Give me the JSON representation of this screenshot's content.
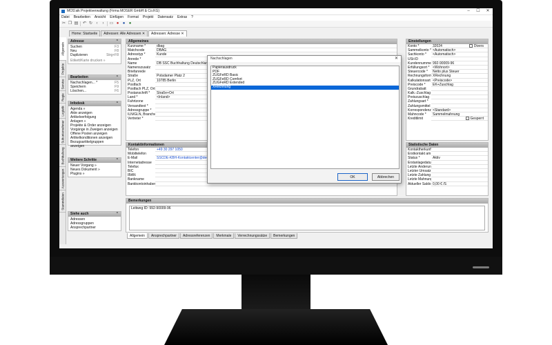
{
  "window": {
    "title": "MOS'aik Projektverwaltung (Firma MOSER GmbH & Co.KG)"
  },
  "menu": [
    "Datei",
    "Bearbeiten",
    "Ansicht",
    "Einfügen",
    "Format",
    "Projekt",
    "Datensatz",
    "Extras",
    "?"
  ],
  "tabs": [
    "Home: Startseite",
    "Adressen: Alle Adressen ✕",
    "Adressen: Adresse ✕"
  ],
  "vtabs": [
    "Allgemein",
    "Projekte",
    "Service",
    "Regie",
    "Logistik",
    "Subunternehmer",
    "Buchhaltung",
    "Auswertungen",
    "Stammdaten"
  ],
  "sidebar": {
    "adresse": {
      "title": "Adresse",
      "items": [
        [
          "Suchen",
          "F3"
        ],
        [
          "Neu",
          "F8"
        ],
        [
          "Duplizieren",
          "Strg+F8"
        ]
      ],
      "extra": "Etikett/Karte drucken »"
    },
    "bearbeiten": {
      "title": "Bearbeiten",
      "items": [
        [
          "Nachschlagen... *",
          "F5"
        ],
        [
          "Speichern",
          "F9"
        ],
        [
          "Löschen...",
          "F6"
        ]
      ]
    },
    "infodesk": {
      "title": "Infodesk",
      "items": [
        "Agenda »",
        "Akte anzeigen",
        "Artikelverfolgung",
        "Anlagen »",
        "Projekte & Order anzeigen",
        "Vorgänge in Zweigen anzeigen",
        "Offene Posten anzeigen",
        "Artikelkonditionen anzeigen",
        "Bezugsartikelgruppen anzeigen"
      ]
    },
    "weitere": {
      "title": "Weitere Schritte",
      "items": [
        "Neuer Vorgang »",
        "Neues Dokument »",
        "Plugins »"
      ]
    },
    "siehe": {
      "title": "Siehe auch",
      "items": [
        "Adressen",
        "Adressgruppen",
        "Ansprechpartner"
      ]
    }
  },
  "allgemeines": {
    "title": "Allgemeines",
    "fields": [
      [
        "Kurzname *",
        "dbag"
      ],
      [
        "Matchcode",
        "DBAG"
      ],
      [
        "Adresstyp *",
        "Kunde"
      ],
      [
        "Anrede *",
        ""
      ],
      [
        "Name",
        "DB SSC Buchhaltung Deutschland"
      ],
      [
        "Namenszusatz",
        ""
      ],
      [
        "Briefanrede",
        ""
      ],
      [
        "Straße",
        "Potsdamer Platz 2"
      ],
      [
        "PLZ, Ort",
        "10785      Berlin"
      ],
      [
        "Postfach",
        ""
      ],
      [
        "Postfach PLZ, Ort",
        ""
      ],
      [
        "Postanschrift *",
        "Straße+Ort"
      ],
      [
        "Land *",
        "<Inland>"
      ],
      [
        "Fahrtzone",
        ""
      ],
      [
        "Versandtext *",
        ""
      ],
      [
        "Adressgruppe *",
        ""
      ],
      [
        "ILN/GLN, Branche",
        ""
      ],
      [
        "Vertreter *",
        ""
      ]
    ]
  },
  "kontakt": {
    "title": "Kontaktinformationen",
    "fields": [
      [
        "Telefon",
        "+49 30 297 1050"
      ],
      [
        "Mobiltelefon",
        ""
      ],
      [
        "E-Mail",
        "SSCDE-KBH-Kontaktcenter@deutschebahn.com"
      ],
      [
        "Internetadresse",
        ""
      ],
      [
        "Telefax",
        ""
      ],
      [
        "BIC",
        ""
      ],
      [
        "IBAN",
        ""
      ],
      [
        "Bankname",
        ""
      ],
      [
        "Bankkontoinhaber",
        ""
      ]
    ]
  },
  "bemerkungen": {
    "title": "Bemerkungen",
    "text": "Leitweg ID: 992-90009-96"
  },
  "bottom_tabs": [
    "Allgemein",
    "Ansprechpartner",
    "Adressreferenzen",
    "Merkmale",
    "Verrechnungssätze",
    "Bemerkungen"
  ],
  "einstellungen": {
    "title": "Einstellungen",
    "fields": [
      [
        "Konto *",
        "32024"
      ],
      [
        "Sammelkonto *",
        "<Automatisch>"
      ],
      [
        "Sachkonto *",
        "<Automatisch>"
      ],
      [
        "USt-ID",
        ""
      ],
      [
        "Kundennummer",
        "992-90009-96"
      ],
      [
        "Erfüllungsort *",
        "<Wohnort>"
      ],
      [
        "Steuercode *",
        "Netto plus Steuer"
      ],
      [
        "Rechnungsform *",
        "XRechnung"
      ],
      [
        "Kalkulationsart *",
        "<Preiscode>"
      ],
      [
        "Preiscode *",
        "EK+Zuschlag"
      ],
      [
        "Grundrabatt",
        ""
      ],
      [
        "Kalk.-Zuschlag",
        ""
      ],
      [
        "Preiszuschlag",
        ""
      ],
      [
        "Zahlungsart *",
        ""
      ],
      [
        "Zahlungsmittel *",
        ""
      ],
      [
        "Korrespondenz *",
        "<Standard>"
      ],
      [
        "Mahncode *",
        "Sammelmahnung"
      ],
      [
        "Kreditlimit",
        ""
      ]
    ],
    "divers_label": "Divers",
    "gesperrt_label": "Gesperrt"
  },
  "statistische": {
    "title": "Statistische Daten",
    "fields": [
      [
        "Kontaktherkunft",
        ""
      ],
      [
        "Erstkontakt am *",
        ""
      ],
      [
        "Status *",
        "Aktiv"
      ],
      [
        "Erstanlagedatum",
        ""
      ],
      [
        "Letzte Änderung",
        ""
      ],
      [
        "Letzter Umsatz",
        ""
      ],
      [
        "Letzte Zahlung",
        ""
      ],
      [
        "Letzte Mahnung",
        ""
      ],
      [
        "Aktueller Saldo",
        "0,00 € /S"
      ]
    ]
  },
  "dialog": {
    "title": "Nachschlagen",
    "items": [
      "Papierausdruck",
      "PDF",
      "ZUGFeRD Basic",
      "ZUGFeRD Comfort",
      "ZUGFeRD Extended",
      "XRechnung"
    ],
    "selected_index": 5,
    "ok_label": "OK",
    "cancel_label": "Abbrechen"
  }
}
